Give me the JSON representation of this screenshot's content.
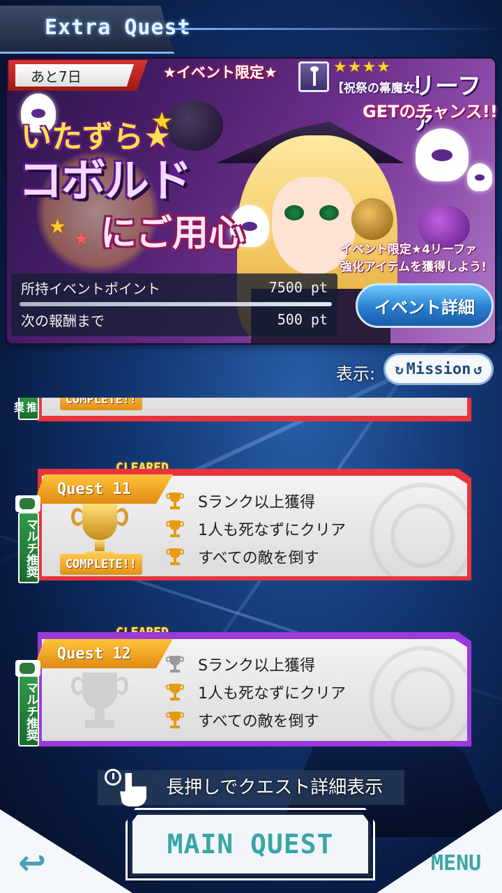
{
  "header": {
    "title": "Extra Quest"
  },
  "banner": {
    "days_left": "あと7日",
    "event_limited": "★イベント限定★",
    "rarity_stars": "★★★★",
    "character_title": "【祝祭の箒魔女】",
    "character_name": "リーファ",
    "get_chance": "GETのチャンス!!",
    "event_title_line1": "いたずら★",
    "event_title_line2": "コボルド",
    "event_title_line3": "にご用心",
    "enhance_note_line1": "イベント限定★4リーファ",
    "enhance_note_line2": "強化アイテムを獲得しよう!",
    "points_label": "所持イベントポイント",
    "points_value": "7500 pt",
    "next_reward_label": "次の報酬まで",
    "next_reward_value": "500 pt",
    "event_detail_button": "イベント詳細"
  },
  "display_mode": {
    "label": "表示:",
    "toggle_label": "Mission"
  },
  "quests": [
    {
      "name": "Quest 11",
      "cleared_label": "CLEARED",
      "complete_label": "COMPLETE!!",
      "multi_label": "マルチ推奨",
      "status": "complete",
      "missions": [
        {
          "label": "Sランク以上獲得",
          "achieved": true
        },
        {
          "label": "1人も死なずにクリア",
          "achieved": true
        },
        {
          "label": "すべての敵を倒す",
          "achieved": true
        }
      ]
    },
    {
      "name": "Quest 12",
      "cleared_label": "CLEARED",
      "multi_label": "マルチ推奨",
      "status": "incomplete",
      "missions": [
        {
          "label": "Sランク以上獲得",
          "achieved": false
        },
        {
          "label": "1人も死なずにクリア",
          "achieved": true
        },
        {
          "label": "すべての敵を倒す",
          "achieved": true
        }
      ]
    }
  ],
  "partial_quest": {
    "complete_label": "COMPLETE!!",
    "multi_label": "推奨"
  },
  "footer": {
    "hint": "長押しでクエスト詳細表示",
    "main_quest_button": "MAIN QUEST",
    "menu_button": "MENU",
    "back_icon": "back-arrow-icon"
  },
  "colors": {
    "quest11_border": "#e8343c",
    "quest12_border": "#9a3ad8",
    "trophy_gold": "#e79a14",
    "trophy_gray": "#9a9a9a",
    "accent_teal": "#3aa6a6"
  }
}
